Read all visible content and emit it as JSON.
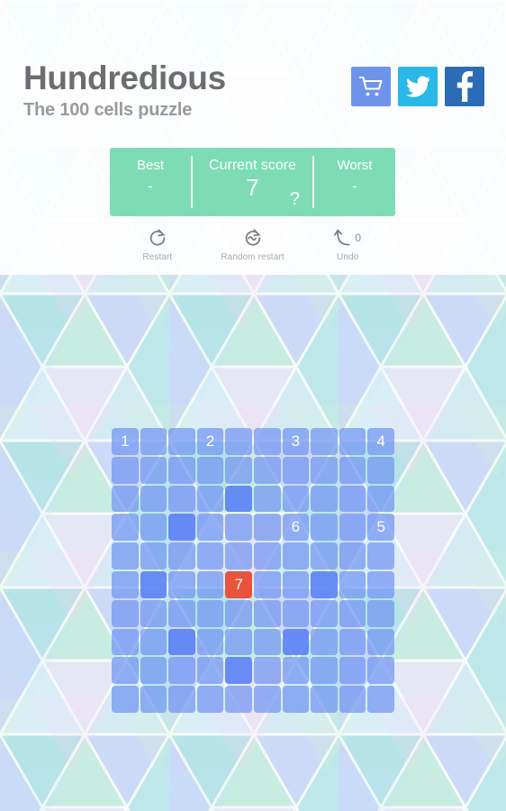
{
  "header": {
    "title": "Hundredious",
    "subtitle": "The 100 cells puzzle",
    "icons": [
      {
        "name": "cart-icon",
        "label": "Shop",
        "color": "#6e93ea"
      },
      {
        "name": "twitter-icon",
        "label": "Twitter",
        "color": "#2ab8e8"
      },
      {
        "name": "facebook-icon",
        "label": "Facebook",
        "color": "#2b6cb4"
      }
    ]
  },
  "score": {
    "panel_color": "#7ddcb6",
    "best_label": "Best",
    "best_value": "-",
    "current_label": "Current score",
    "current_value": "7",
    "help_label": "?",
    "worst_label": "Worst",
    "worst_value": "-"
  },
  "actions": [
    {
      "name": "restart-button",
      "icon": "restart-icon",
      "label": "Restart",
      "count": ""
    },
    {
      "name": "random-restart-button",
      "icon": "random-restart-icon",
      "label": "Random restart",
      "count": ""
    },
    {
      "name": "undo-button",
      "icon": "undo-icon",
      "label": "Undo",
      "count": "0"
    }
  ],
  "board": {
    "rows": 10,
    "cols": 10,
    "cell_color": "#7094f3",
    "highlight_color": "#567ef6",
    "active_color": "#e8533c",
    "cells": [
      [
        "1",
        "",
        "",
        "2",
        "",
        "",
        "3",
        "",
        "",
        "4"
      ],
      [
        "",
        "",
        "",
        "",
        "",
        "",
        "",
        "",
        "",
        ""
      ],
      [
        "",
        "",
        "",
        "",
        "D",
        "",
        "",
        "",
        "",
        ""
      ],
      [
        "",
        "",
        "D",
        "",
        "",
        "",
        "6",
        "",
        "",
        "5"
      ],
      [
        "",
        "",
        "",
        "",
        "",
        "",
        "",
        "",
        "",
        ""
      ],
      [
        "",
        "D",
        "",
        "",
        "7*",
        "",
        "",
        "D",
        "",
        ""
      ],
      [
        "",
        "",
        "",
        "",
        "",
        "",
        "",
        "",
        "",
        ""
      ],
      [
        "",
        "",
        "D",
        "",
        "",
        "",
        "D",
        "",
        "",
        ""
      ],
      [
        "",
        "",
        "",
        "",
        "D",
        "",
        "",
        "",
        "",
        ""
      ],
      [
        "",
        "",
        "",
        "",
        "",
        "",
        "",
        "",
        "",
        ""
      ]
    ]
  },
  "background": {
    "palette": [
      "#a8dde4",
      "#bcc9f7",
      "#b9ebdd",
      "#e8e4f7",
      "#f3e4f3",
      "#cfeaf8",
      "#d5e8fb",
      "#c9ebe0",
      "#d7f7d2",
      "#b4e2ea",
      "#c6d4f8",
      "#e4f7ee"
    ]
  }
}
